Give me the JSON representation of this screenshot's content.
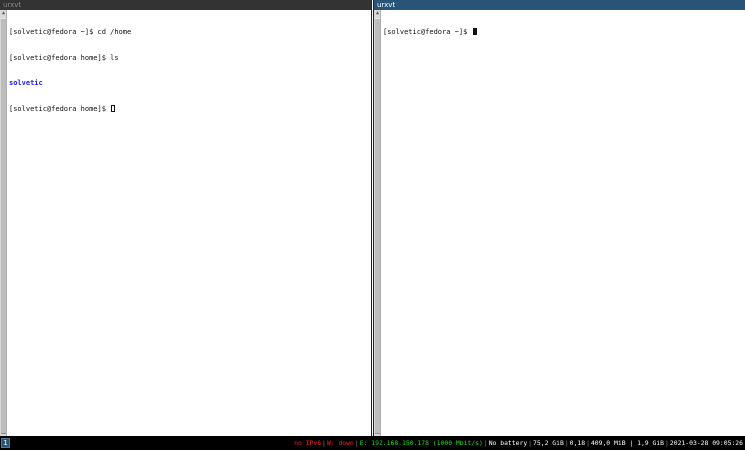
{
  "left_pane": {
    "title": "urxvt",
    "lines": [
      "[solvetic@fedora ~]$ cd /home",
      "[solvetic@fedora home]$ ls"
    ],
    "dir_entry": "solvetic",
    "prompt": "[solvetic@fedora home]$ "
  },
  "right_pane": {
    "title": "urxvt",
    "prompt": "[solvetic@fedora ~]$ "
  },
  "statusbar": {
    "workspace": "1",
    "ipv6": "no IPv6",
    "wifi": "W: down",
    "ethernet": "E: 192.168.150.178 (1000 Mbit/s)",
    "battery": "No battery",
    "disk": "75,2 GiB",
    "load": "0,18",
    "memory": "409,0 MiB | 1,9 GiB",
    "datetime": "2021-03-28 09:05:26",
    "colors": {
      "bad": "#ff2222",
      "good": "#22dd22",
      "workspace_focused": "#285577"
    }
  }
}
